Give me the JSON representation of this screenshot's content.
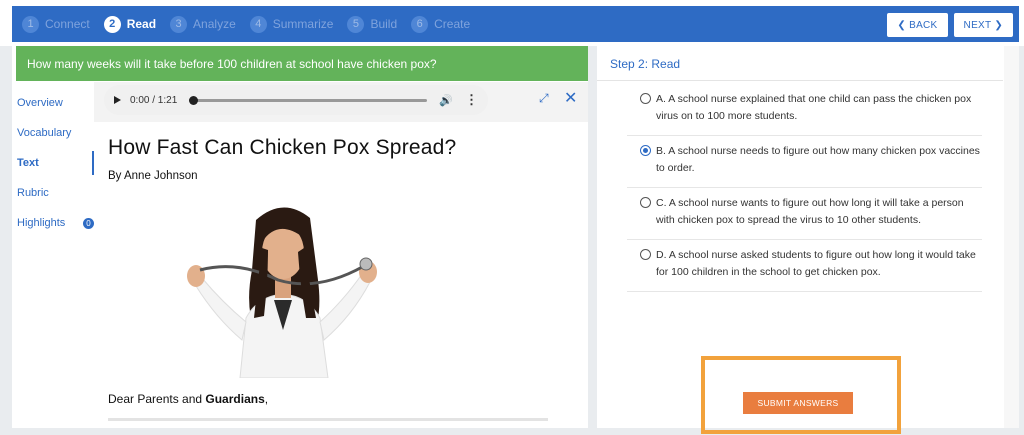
{
  "steps": [
    {
      "num": "1",
      "label": "Connect",
      "active": false
    },
    {
      "num": "2",
      "label": "Read",
      "active": true
    },
    {
      "num": "3",
      "label": "Analyze",
      "active": false
    },
    {
      "num": "4",
      "label": "Summarize",
      "active": false
    },
    {
      "num": "5",
      "label": "Build",
      "active": false
    },
    {
      "num": "6",
      "label": "Create",
      "active": false
    }
  ],
  "nav": {
    "back_label": "❮ BACK",
    "next_label": "NEXT ❯"
  },
  "question": "How many weeks will it take before 100 children at school have chicken pox?",
  "sidenav": {
    "items": [
      "Overview",
      "Vocabulary",
      "Text",
      "Rubric",
      "Highlights"
    ],
    "active_index": 2,
    "highlights_count": "0"
  },
  "player": {
    "time": "0:00 / 1:21"
  },
  "article": {
    "title": "How Fast Can Chicken Pox Spread?",
    "author": "By Anne Johnson",
    "greeting_prefix": "Dear Parents and ",
    "greeting_bold": "Guardians",
    "greeting_suffix": ","
  },
  "right": {
    "step_title": "Step 2: Read",
    "options": [
      {
        "text": "A. A school nurse explained that one child can pass the chicken pox virus on to 100 more students.",
        "checked": false
      },
      {
        "text": "B. A school nurse needs to figure out how many chicken pox vaccines to order.",
        "checked": true
      },
      {
        "text": "C. A school nurse wants to figure out how long it will take a person with chicken pox to spread the virus to 10 other students.",
        "checked": false
      },
      {
        "text": "D. A school nurse asked students to figure out how long it would take for 100 children in the school to get chicken pox.",
        "checked": false
      }
    ],
    "submit_label": "SUBMIT ANSWERS"
  },
  "colors": {
    "brand_blue": "#2e6bc4",
    "question_green": "#63b35a",
    "submit_orange": "#e97d3f",
    "highlight_outline": "#f2a23c"
  },
  "icons": [
    "play-icon",
    "volume-icon",
    "more-options-icon",
    "expand-icon",
    "close-icon"
  ]
}
